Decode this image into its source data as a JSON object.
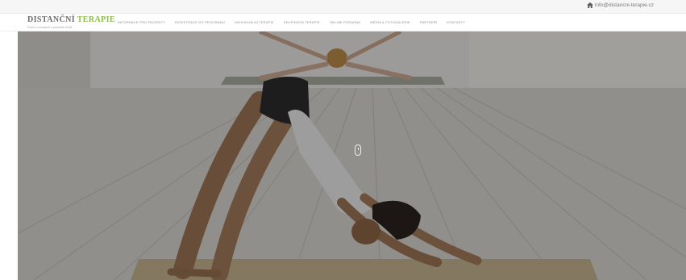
{
  "topbar": {
    "email": "info@distancni-terapie.cz",
    "icon": "home-icon"
  },
  "header": {
    "logo_part1": "DISTANČNÍ",
    "logo_part2": "TERAPIE",
    "tagline": "Pomoc v dostupné a pohodlné formě",
    "brand_color": "#8bbd43"
  },
  "nav": {
    "items": [
      "Informace pro pacienty",
      "Registrace do programu",
      "Individuální terapie",
      "Skupinová terapie",
      "Online poradna",
      "Média & Fotogalerie",
      "Partneři",
      "Kontakty"
    ]
  },
  "hero": {
    "image": "yoga-photo",
    "scroll_icon": "mouse-scroll-icon"
  }
}
